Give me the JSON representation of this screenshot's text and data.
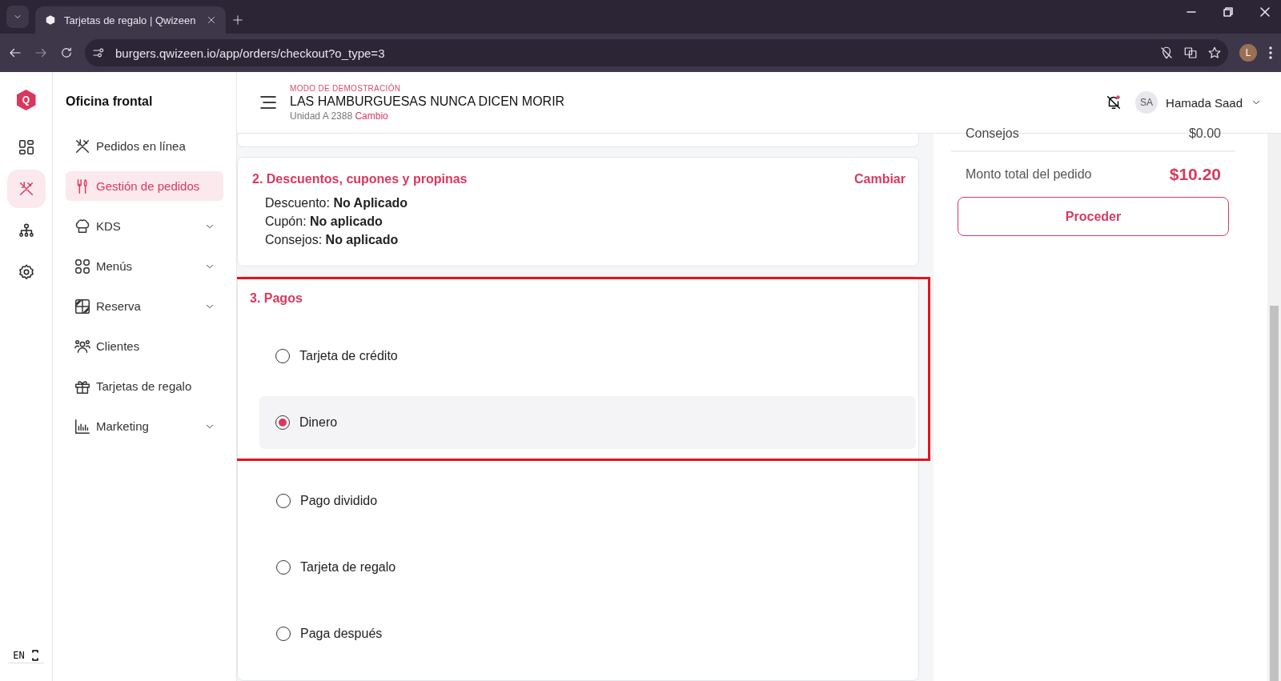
{
  "browser": {
    "tab_title": "Tarjetas de regalo | Qwizeen",
    "url": "burgers.qwizeen.io/app/orders/checkout?o_type=3",
    "profile_initial": "L"
  },
  "rail": {
    "logo": "Q",
    "items": [
      {
        "selected": false
      },
      {
        "selected": true
      },
      {
        "selected": false
      },
      {
        "selected": false
      }
    ],
    "language": "EN"
  },
  "sidebar": {
    "title": "Oficina frontal",
    "items": [
      {
        "label": "Pedidos en línea",
        "selected": false,
        "expandable": false
      },
      {
        "label": "Gestión de pedidos",
        "selected": true,
        "expandable": false
      },
      {
        "label": "KDS",
        "selected": false,
        "expandable": true
      },
      {
        "label": "Menús",
        "selected": false,
        "expandable": true
      },
      {
        "label": "Reserva",
        "selected": false,
        "expandable": true
      },
      {
        "label": "Clientes",
        "selected": false,
        "expandable": false
      },
      {
        "label": "Tarjetas de regalo",
        "selected": false,
        "expandable": false
      },
      {
        "label": "Marketing",
        "selected": false,
        "expandable": true
      }
    ]
  },
  "header": {
    "mode": "MODO DE DEMOSTRACIÓN",
    "restaurant": "LAS HAMBURGUESAS NUNCA DICEN MORIR",
    "unit": "Unidad A 2388",
    "change_link": "Cambio",
    "user_initials": "SA",
    "user_name": "Hamada Saad"
  },
  "discounts": {
    "title": "2. Descuentos, cupones y propinas",
    "action": "Cambiar",
    "lines": [
      "Descuento: **No Aplicado**",
      "Cupón: **No aplicado**",
      "Consejos: **No aplicado**"
    ]
  },
  "payments": {
    "title": "3. Pagos",
    "options": [
      {
        "label": "Tarjeta de crédito",
        "selected": false,
        "in_frame": true
      },
      {
        "label": "Dinero",
        "selected": true,
        "in_frame": true
      },
      {
        "label": "Pago dividido",
        "selected": false,
        "in_frame": false
      },
      {
        "label": "Tarjeta de regalo",
        "selected": false,
        "in_frame": false
      },
      {
        "label": "Paga después",
        "selected": false,
        "in_frame": false
      }
    ]
  },
  "summary": {
    "tips_label": "Consejos",
    "tips_value": "$0.00",
    "total_label": "Monto total del pedido",
    "total_value": "$10.20",
    "button": "Proceder"
  }
}
